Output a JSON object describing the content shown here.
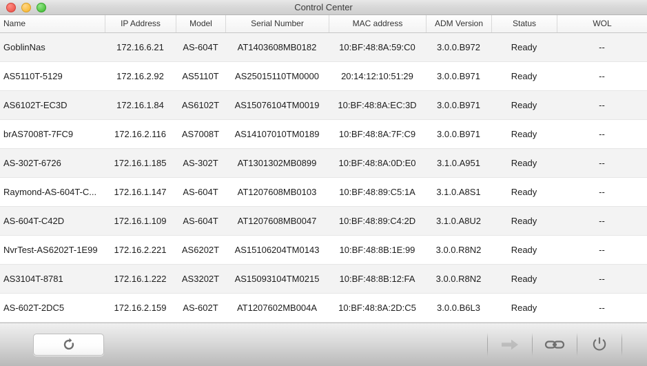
{
  "window": {
    "title": "Control Center",
    "controls": [
      {
        "name": "close",
        "label": "Close"
      },
      {
        "name": "minimize",
        "label": "Minimize"
      },
      {
        "name": "zoom",
        "label": "Zoom"
      }
    ]
  },
  "table": {
    "columns": [
      {
        "key": "name",
        "label": "Name",
        "align": "left"
      },
      {
        "key": "ip",
        "label": "IP Address",
        "align": "center"
      },
      {
        "key": "model",
        "label": "Model",
        "align": "center"
      },
      {
        "key": "serial",
        "label": "Serial Number",
        "align": "center"
      },
      {
        "key": "mac",
        "label": "MAC address",
        "align": "center"
      },
      {
        "key": "adm",
        "label": "ADM Version",
        "align": "center"
      },
      {
        "key": "status",
        "label": "Status",
        "align": "center"
      },
      {
        "key": "wol",
        "label": "WOL",
        "align": "center"
      }
    ],
    "rows": [
      {
        "name": "GoblinNas",
        "ip": "172.16.6.21",
        "model": "AS-604T",
        "serial": "AT1403608MB0182",
        "mac": "10:BF:48:8A:59:C0",
        "adm": "3.0.0.B972",
        "status": "Ready",
        "wol": "--"
      },
      {
        "name": "AS5110T-5129",
        "ip": "172.16.2.92",
        "model": "AS5110T",
        "serial": "AS25015110TM0000",
        "mac": "20:14:12:10:51:29",
        "adm": "3.0.0.B971",
        "status": "Ready",
        "wol": "--"
      },
      {
        "name": "AS6102T-EC3D",
        "ip": "172.16.1.84",
        "model": "AS6102T",
        "serial": "AS15076104TM0019",
        "mac": "10:BF:48:8A:EC:3D",
        "adm": "3.0.0.B971",
        "status": "Ready",
        "wol": "--"
      },
      {
        "name": "brAS7008T-7FC9",
        "ip": "172.16.2.116",
        "model": "AS7008T",
        "serial": "AS14107010TM0189",
        "mac": "10:BF:48:8A:7F:C9",
        "adm": "3.0.0.B971",
        "status": "Ready",
        "wol": "--"
      },
      {
        "name": "AS-302T-6726",
        "ip": "172.16.1.185",
        "model": "AS-302T",
        "serial": "AT1301302MB0899",
        "mac": "10:BF:48:8A:0D:E0",
        "adm": "3.1.0.A951",
        "status": "Ready",
        "wol": "--"
      },
      {
        "name": "Raymond-AS-604T-C...",
        "ip": "172.16.1.147",
        "model": "AS-604T",
        "serial": "AT1207608MB0103",
        "mac": "10:BF:48:89:C5:1A",
        "adm": "3.1.0.A8S1",
        "status": "Ready",
        "wol": "--"
      },
      {
        "name": "AS-604T-C42D",
        "ip": "172.16.1.109",
        "model": "AS-604T",
        "serial": "AT1207608MB0047",
        "mac": "10:BF:48:89:C4:2D",
        "adm": "3.1.0.A8U2",
        "status": "Ready",
        "wol": "--"
      },
      {
        "name": "NvrTest-AS6202T-1E99",
        "ip": "172.16.2.221",
        "model": "AS6202T",
        "serial": "AS15106204TM0143",
        "mac": "10:BF:48:8B:1E:99",
        "adm": "3.0.0.R8N2",
        "status": "Ready",
        "wol": "--"
      },
      {
        "name": "AS3104T-8781",
        "ip": "172.16.1.222",
        "model": "AS3202T",
        "serial": "AS15093104TM0215",
        "mac": "10:BF:48:8B:12:FA",
        "adm": "3.0.0.R8N2",
        "status": "Ready",
        "wol": "--"
      },
      {
        "name": "AS-602T-2DC5",
        "ip": "172.16.2.159",
        "model": "AS-602T",
        "serial": "AT1207602MB004A",
        "mac": "10:BF:48:8A:2D:C5",
        "adm": "3.0.0.B6L3",
        "status": "Ready",
        "wol": "--"
      }
    ]
  },
  "toolbar": {
    "refresh": {
      "icon": "refresh-icon",
      "label": ""
    },
    "actions": [
      {
        "icon": "arrow-right-icon",
        "label": "",
        "enabled": false
      },
      {
        "icon": "link-icon",
        "label": "",
        "enabled": true
      },
      {
        "icon": "power-icon",
        "label": "",
        "enabled": true
      }
    ]
  },
  "colors": {
    "close": "#ef5f56",
    "minimize": "#f9bd3f",
    "zoom": "#53c544",
    "row_alt": "#f3f3f3",
    "text": "#1d1d1d"
  }
}
